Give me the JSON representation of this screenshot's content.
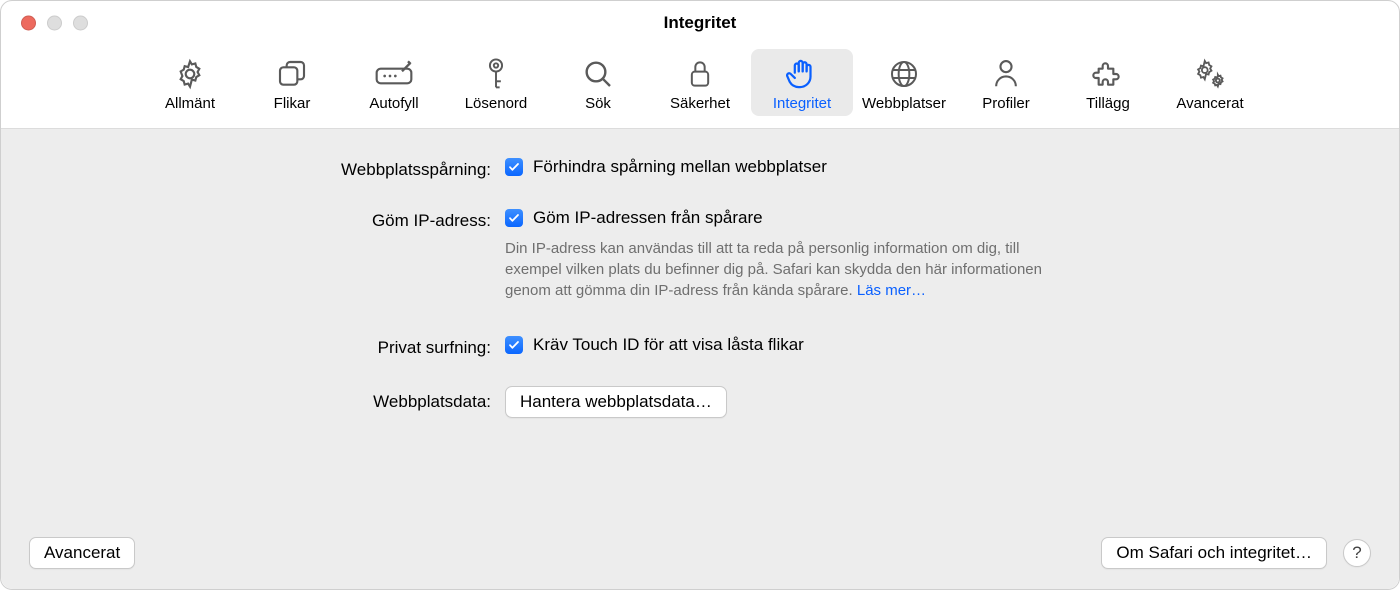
{
  "window": {
    "title": "Integritet"
  },
  "toolbar": {
    "items": [
      {
        "label": "Allmänt"
      },
      {
        "label": "Flikar"
      },
      {
        "label": "Autofyll"
      },
      {
        "label": "Lösenord"
      },
      {
        "label": "Sök"
      },
      {
        "label": "Säkerhet"
      },
      {
        "label": "Integritet"
      },
      {
        "label": "Webbplatser"
      },
      {
        "label": "Profiler"
      },
      {
        "label": "Tillägg"
      },
      {
        "label": "Avancerat"
      }
    ],
    "selected_index": 6
  },
  "settings": {
    "tracking": {
      "label": "Webbplatsspårning:",
      "checkbox_label": "Förhindra spårning mellan webbplatser",
      "checked": true
    },
    "hide_ip": {
      "label": "Göm IP-adress:",
      "checkbox_label": "Göm IP-adressen från spårare",
      "checked": true,
      "description": "Din IP-adress kan användas till att ta reda på personlig information om dig, till exempel vilken plats du befinner dig på. Safari kan skydda den här informationen genom att gömma din IP-adress från kända spårare. ",
      "learn_more": "Läs mer…"
    },
    "private_browsing": {
      "label": "Privat surfning:",
      "checkbox_label": "Kräv Touch ID för att visa låsta flikar",
      "checked": true
    },
    "website_data": {
      "label": "Webbplatsdata:",
      "button": "Hantera webbplatsdata…"
    }
  },
  "footer": {
    "advanced_button": "Avancerat",
    "about_button": "Om Safari och integritet…",
    "help": "?"
  }
}
